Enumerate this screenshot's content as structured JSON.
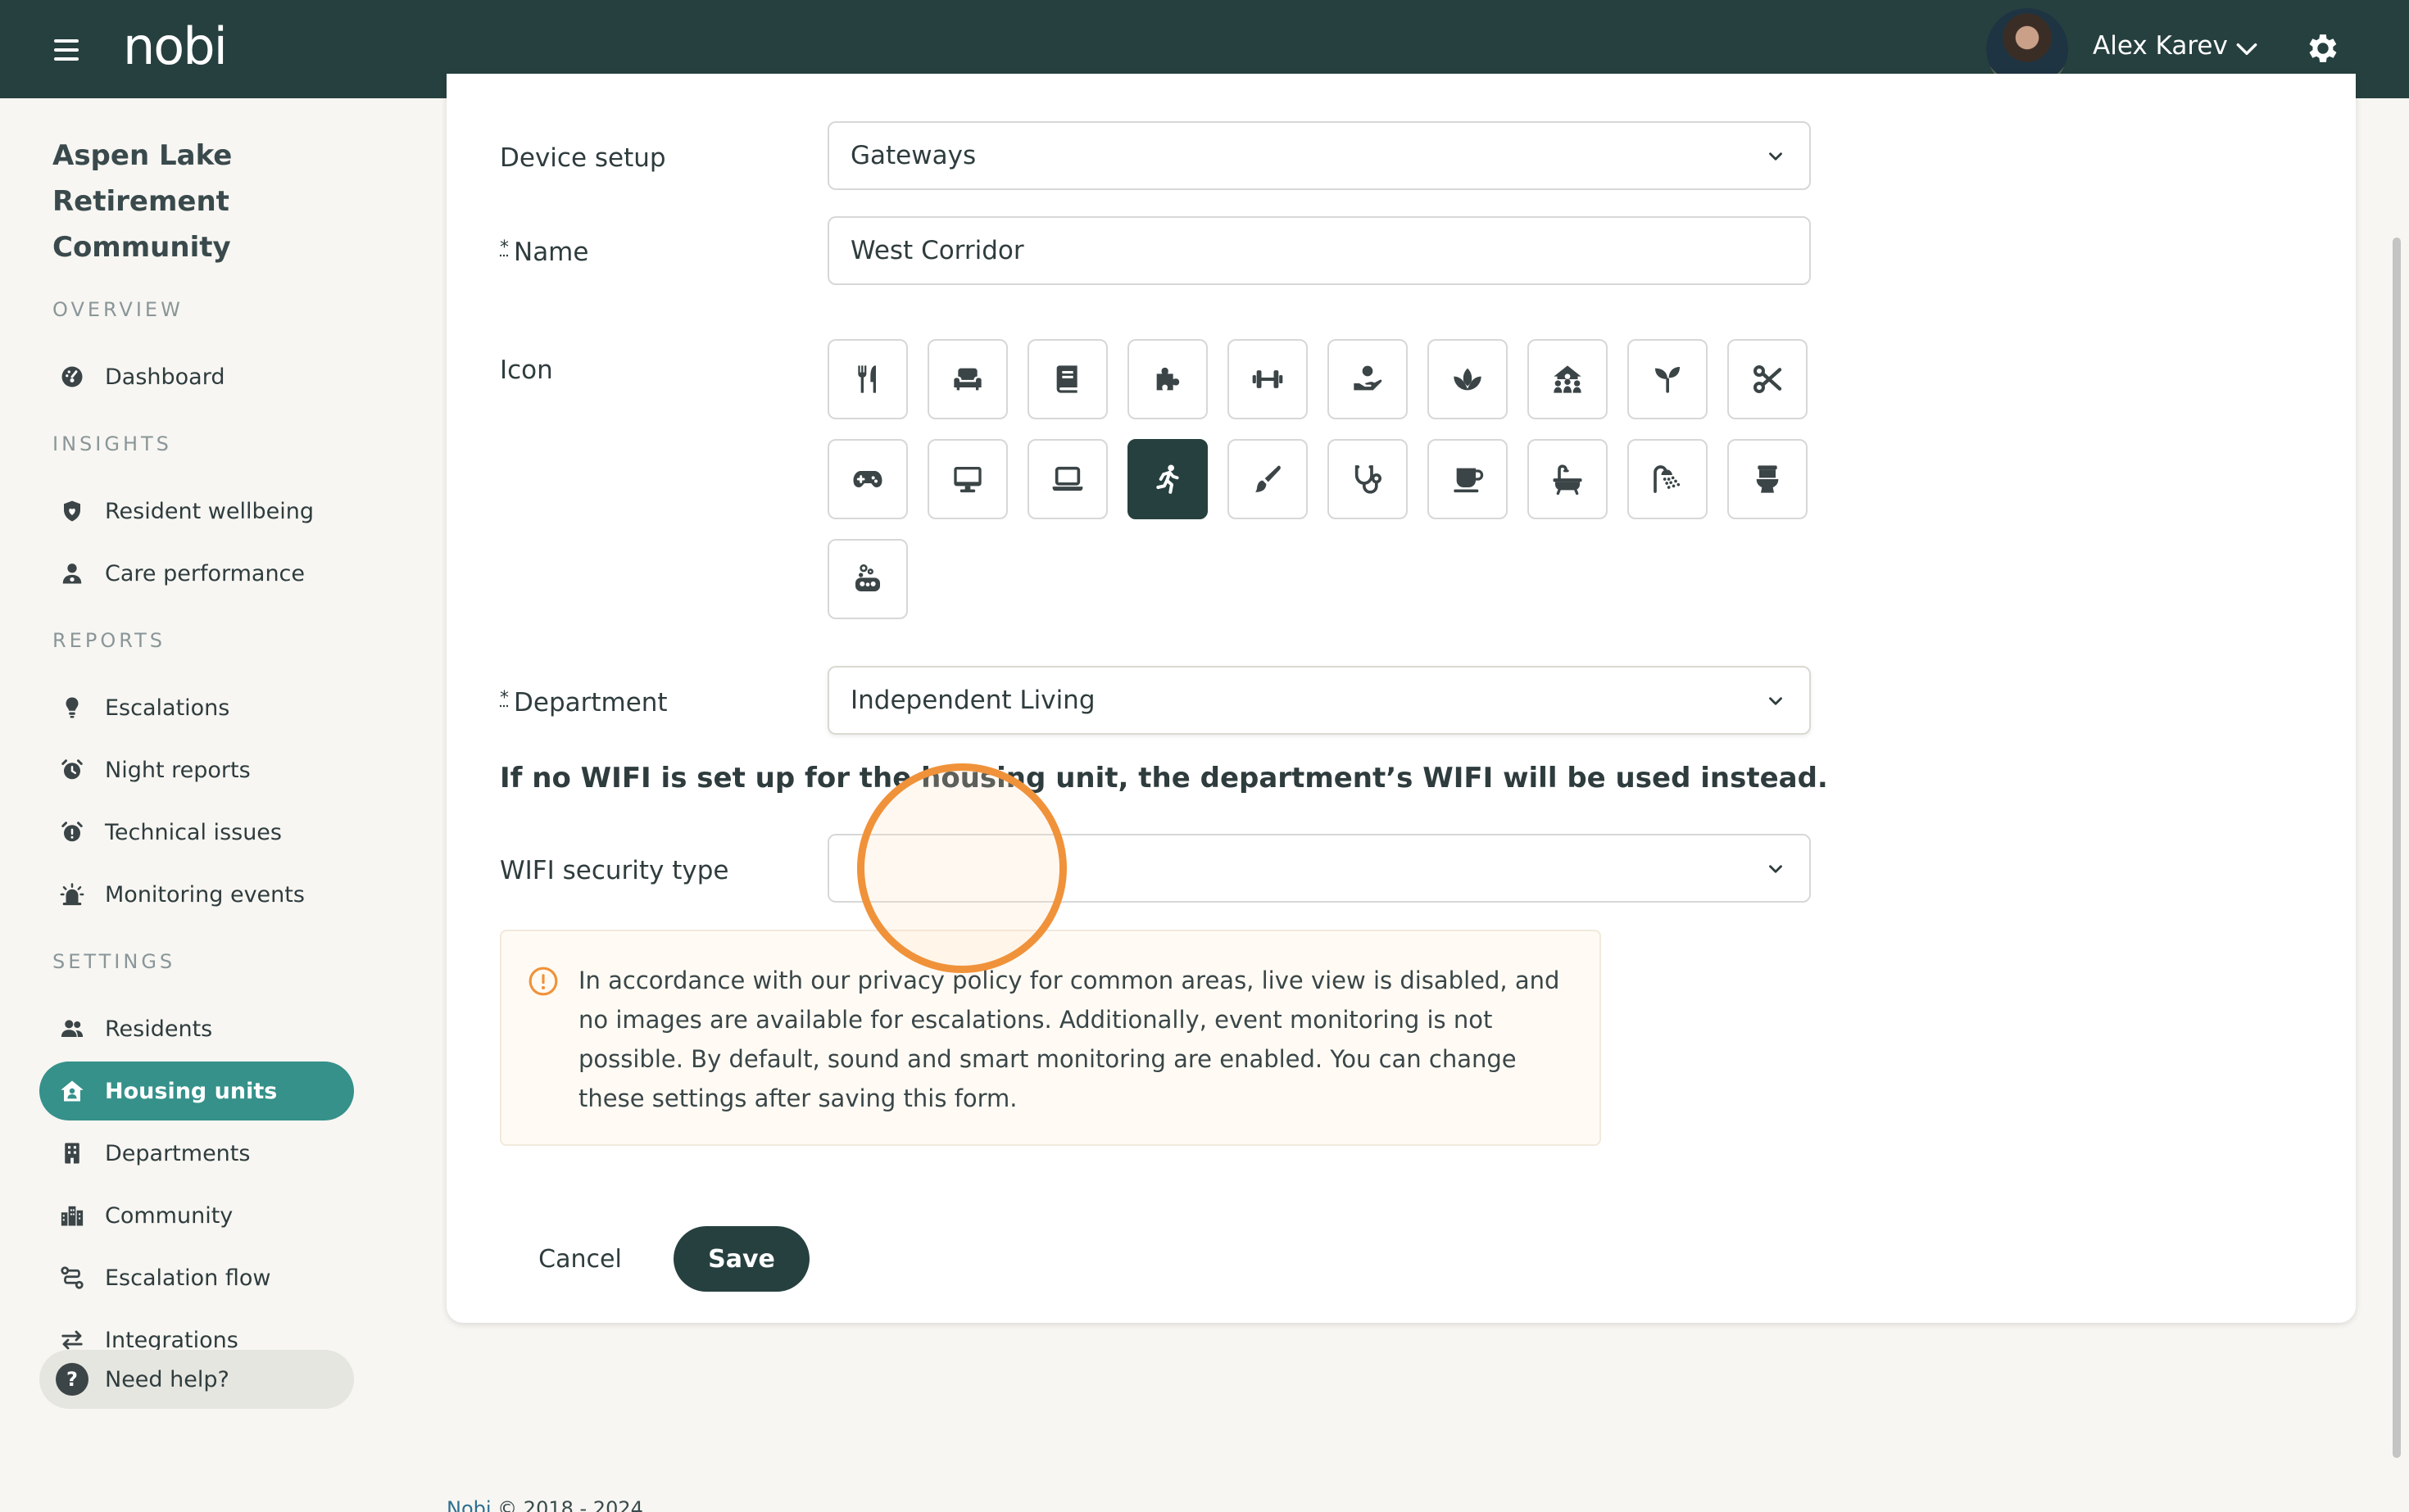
{
  "topbar": {
    "logo": "nobi",
    "user_name": "Alex Karev"
  },
  "sidebar": {
    "org_name": "Aspen Lake Retirement Community",
    "sections": {
      "overview": "OVERVIEW",
      "insights": "INSIGHTS",
      "reports": "REPORTS",
      "settings": "SETTINGS"
    },
    "items": {
      "dashboard": "Dashboard",
      "resident_wellbeing": "Resident wellbeing",
      "care_performance": "Care performance",
      "escalations": "Escalations",
      "night_reports": "Night reports",
      "technical_issues": "Technical issues",
      "monitoring_events": "Monitoring events",
      "residents": "Residents",
      "housing_units": "Housing units",
      "departments": "Departments",
      "community": "Community",
      "escalation_flow": "Escalation flow",
      "integrations": "Integrations"
    },
    "active_item": "housing_units",
    "help": "Need help?"
  },
  "form": {
    "device_setup": {
      "label": "Device setup",
      "value": "Gateways"
    },
    "name": {
      "required_mark": "*",
      "label": "Name",
      "value": "West Corridor"
    },
    "icon": {
      "label": "Icon",
      "options": [
        "utensils-icon",
        "sofa-icon",
        "book-icon",
        "puzzle-icon",
        "dumbbell-icon",
        "care-hand-icon",
        "lotus-icon",
        "group-icon",
        "seedling-icon",
        "scissors-icon",
        "gamepad-icon",
        "desktop-icon",
        "laptop-icon",
        "running-icon",
        "brush-icon",
        "stethoscope-icon",
        "coffee-icon",
        "bath-icon",
        "shower-icon",
        "toilet-icon",
        "soap-icon"
      ],
      "selected": "running-icon"
    },
    "department": {
      "required_mark": "*",
      "label": "Department",
      "value": "Independent Living"
    },
    "wifi_notice": "If no WIFI is set up for the housing unit, the department’s WIFI will be used instead.",
    "wifi_security": {
      "label": "WIFI security type",
      "value": ""
    },
    "privacy_alert": "In accordance with our privacy policy for common areas, live view is disabled, and no images are available for escalations. Additionally, event monitoring is not possible. By default, sound and smart monitoring are enabled. You can change these settings after saving this form.",
    "cancel_label": "Cancel",
    "save_label": "Save"
  },
  "footer": {
    "brand": "Nobi",
    "copyright": " © 2018 - 2024"
  },
  "colors": {
    "topbar": "#26403f",
    "accent_teal": "#35918a",
    "selected_tile": "#26403f",
    "alert_icon": "#f0923a"
  }
}
